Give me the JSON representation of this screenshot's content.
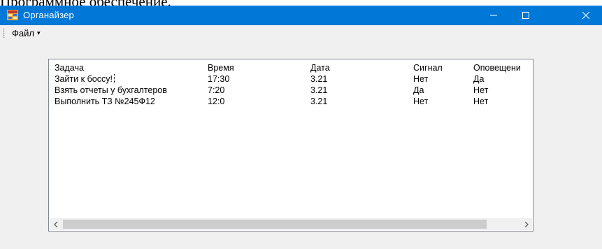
{
  "document": {
    "fragment_text": "Программное обеспечение."
  },
  "window": {
    "title": "Органайзер",
    "controls": {
      "minimize_icon": "minimize-icon",
      "maximize_icon": "maximize-icon",
      "close_icon": "close-icon"
    }
  },
  "menu": {
    "file_label": "Файл",
    "file_caret": "▾"
  },
  "listview": {
    "columns": [
      "Задача",
      "Время",
      "Дата",
      "Сигнал",
      "Оповещени"
    ],
    "rows": [
      [
        "Зайти к боссу!",
        "17:30",
        "3.21",
        "Нет",
        "Да"
      ],
      [
        "Взять отчеты у бухгалтеров",
        "7:20",
        "3.21",
        "Да",
        "Нет"
      ],
      [
        "Выполнить ТЗ №245Ф12",
        "12:0",
        "3.21",
        "Нет",
        "Нет"
      ]
    ],
    "scroll_left": "<",
    "scroll_right": ">"
  },
  "colors": {
    "titlebar": "#0078d7",
    "window_bg": "#f0f0f0",
    "list_bg": "#ffffff",
    "scroll_thumb": "#cdcdcd"
  }
}
